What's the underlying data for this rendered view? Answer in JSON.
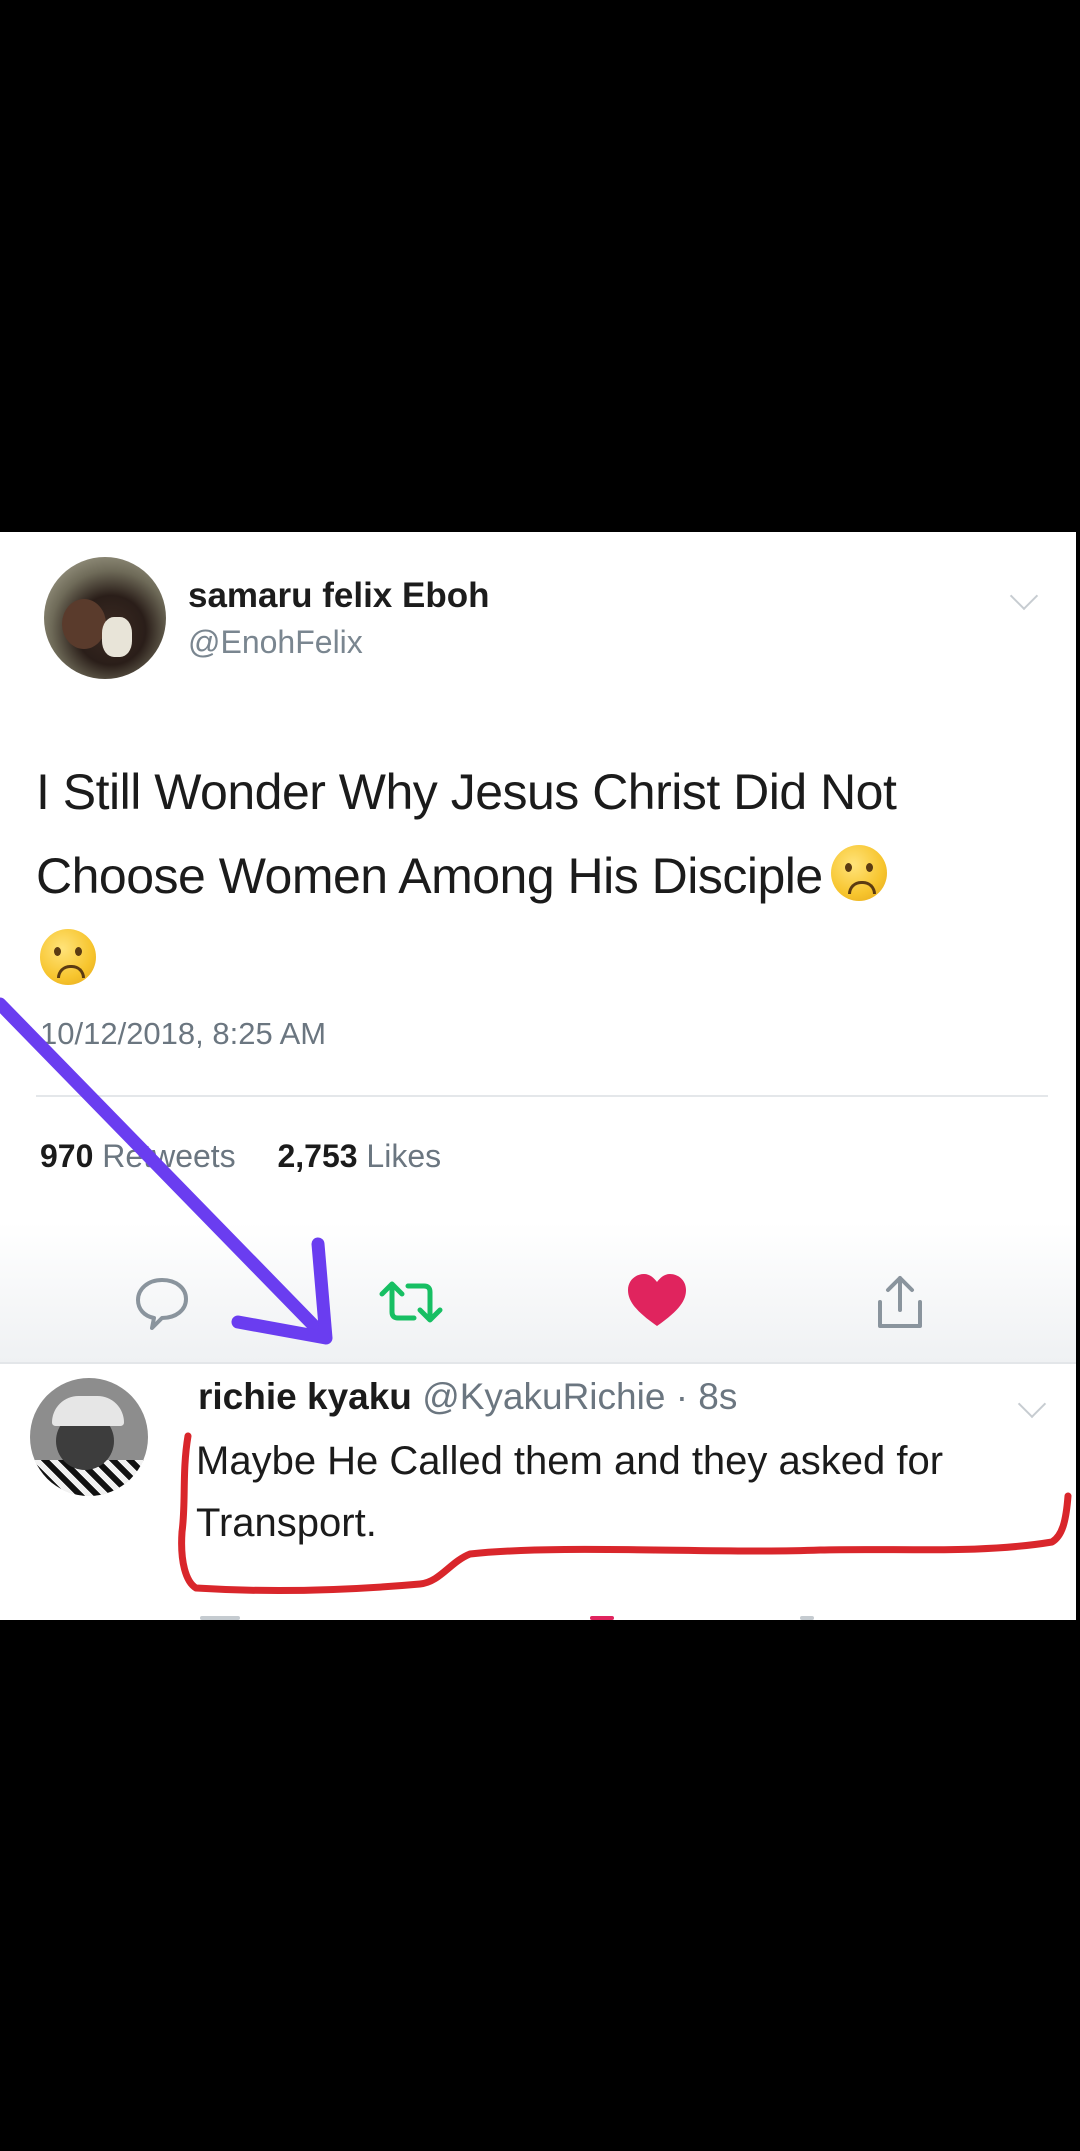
{
  "tweet": {
    "display_name": "samaru felix Eboh",
    "handle": "@EnohFelix",
    "text_line1": "I Still Wonder Why Jesus Christ Did Not",
    "text_line2": "Choose Women Among His Disciple",
    "timestamp": "10/12/2018, 8:25 AM",
    "retweets_count": "970",
    "retweets_label": "Retweets",
    "likes_count": "2,753",
    "likes_label": "Likes"
  },
  "actions": {
    "reply_icon": "speech-bubble-icon",
    "retweet_icon": "retweet-icon",
    "like_icon": "heart-icon",
    "share_icon": "share-icon"
  },
  "reply": {
    "display_name": "richie kyaku",
    "handle": "@KyakuRichie",
    "separator": "·",
    "time": "8s",
    "text_line1": "Maybe He Called them and they asked for",
    "text_line2": "Transport."
  },
  "colors": {
    "retweet_green": "#17bf63",
    "like_red": "#e0245e",
    "annotation_arrow": "#6a3df0",
    "annotation_underline": "#d9262b"
  }
}
